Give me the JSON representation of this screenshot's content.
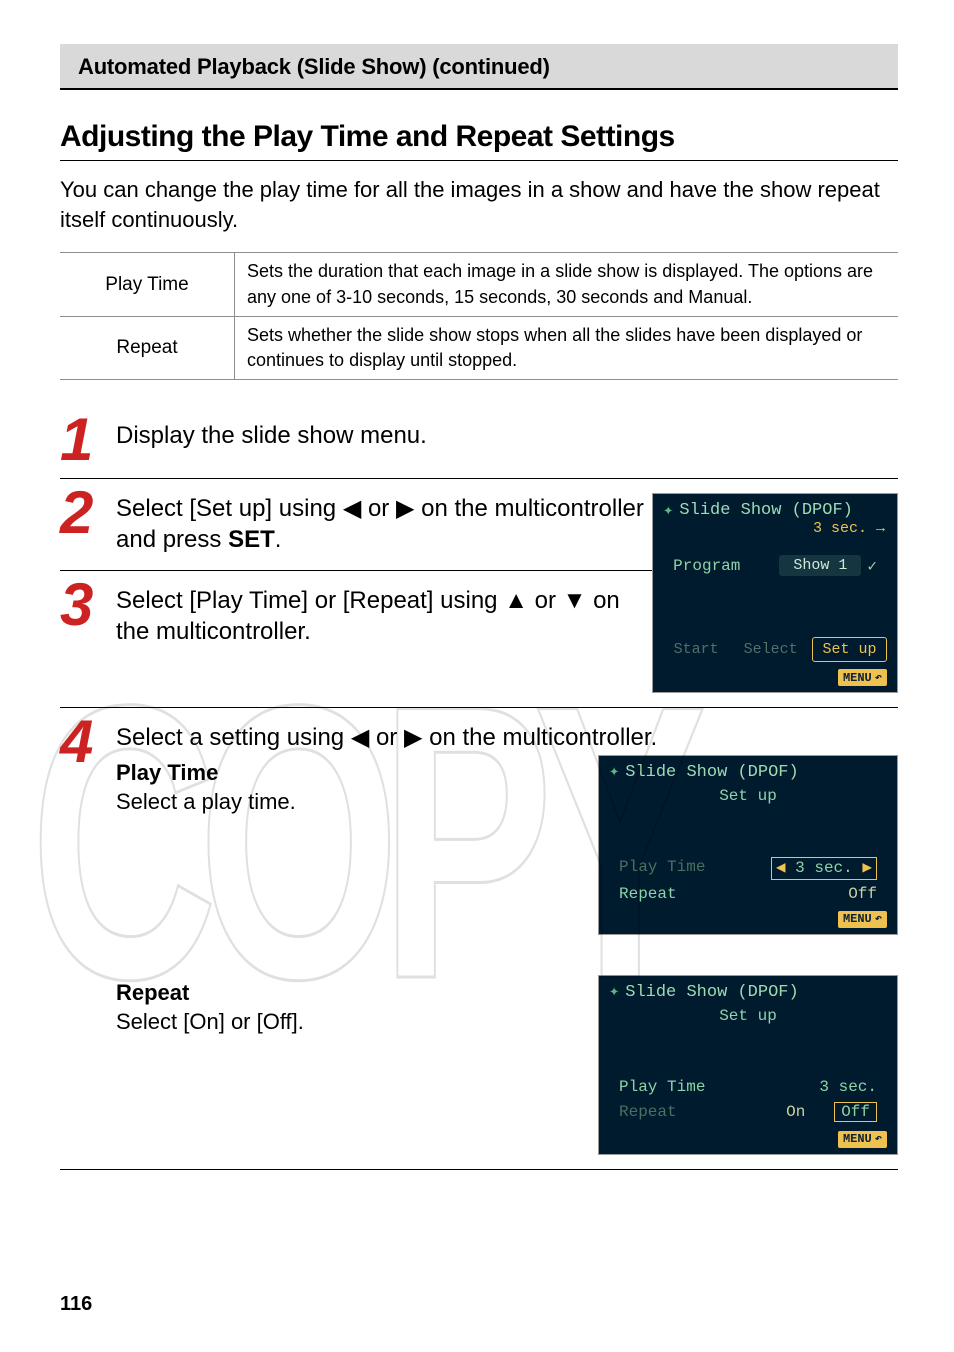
{
  "continued_bar": "Automated Playback (Slide Show) (continued)",
  "section_title": "Adjusting the Play Time and Repeat Settings",
  "section_desc": "You can change the play time for all the images in a show and have the show repeat itself continuously.",
  "table": {
    "rows": [
      {
        "label": "Play Time",
        "desc": "Sets the duration that each image in a slide show is displayed. The options are any one of 3-10 seconds, 15 seconds, 30 seconds and Manual."
      },
      {
        "label": "Repeat",
        "desc": "Sets whether the slide show stops when all the slides have been displayed or continues to display until stopped."
      }
    ]
  },
  "steps": {
    "s1": {
      "text": "Display the slide show menu."
    },
    "s2": {
      "line1a": "Select [Set up] using ",
      "sym_l": "◀",
      "mid": " or ",
      "sym_r": "▶",
      "line1b": " on the multicontroller and press ",
      "set": "SET",
      "end": "."
    },
    "s3": {
      "line1a": "Select [Play Time] or [Repeat] using ",
      "sym_u": "▲",
      "mid": " or ",
      "sym_d": "▼",
      "line1b": " on the multicontroller."
    },
    "s4": {
      "line": "Select a setting using ◀ or ▶ on the multicontroller.",
      "line_a": "Select a setting using ",
      "sym_l": "◀",
      "mid1": " or ",
      "sym_r": "▶",
      "line_b": " on the multicontroller.",
      "pt_title": "Play Time",
      "pt_text": "Select a play time.",
      "rpt_title": "Repeat",
      "rpt_text": "Select [On] or [Off]."
    }
  },
  "lcd1": {
    "title": "Slide Show (DPOF)",
    "topright": "3 sec. →",
    "program": "Program",
    "show1": "Show 1",
    "check": "✓",
    "tab_start": "Start",
    "tab_select": "Select",
    "tab_setup": "Set up",
    "menu": "MENU",
    "back": "↶"
  },
  "lcd2": {
    "title": "Slide Show (DPOF)",
    "sub": "Set up",
    "play_time_k": "Play Time",
    "play_time_v": "3 sec.",
    "tri_l": "◀",
    "tri_r": "▶",
    "repeat_k": "Repeat",
    "repeat_v": "Off",
    "menu": "MENU",
    "back": "↶"
  },
  "lcd3": {
    "title": "Slide Show (DPOF)",
    "sub": "Set up",
    "play_time_k": "Play Time",
    "play_time_v": "3 sec.",
    "repeat_k": "Repeat",
    "repeat_on": "On",
    "repeat_off": "Off",
    "menu": "MENU",
    "back": "↶"
  },
  "page_num": "116",
  "watermark": "COPY"
}
